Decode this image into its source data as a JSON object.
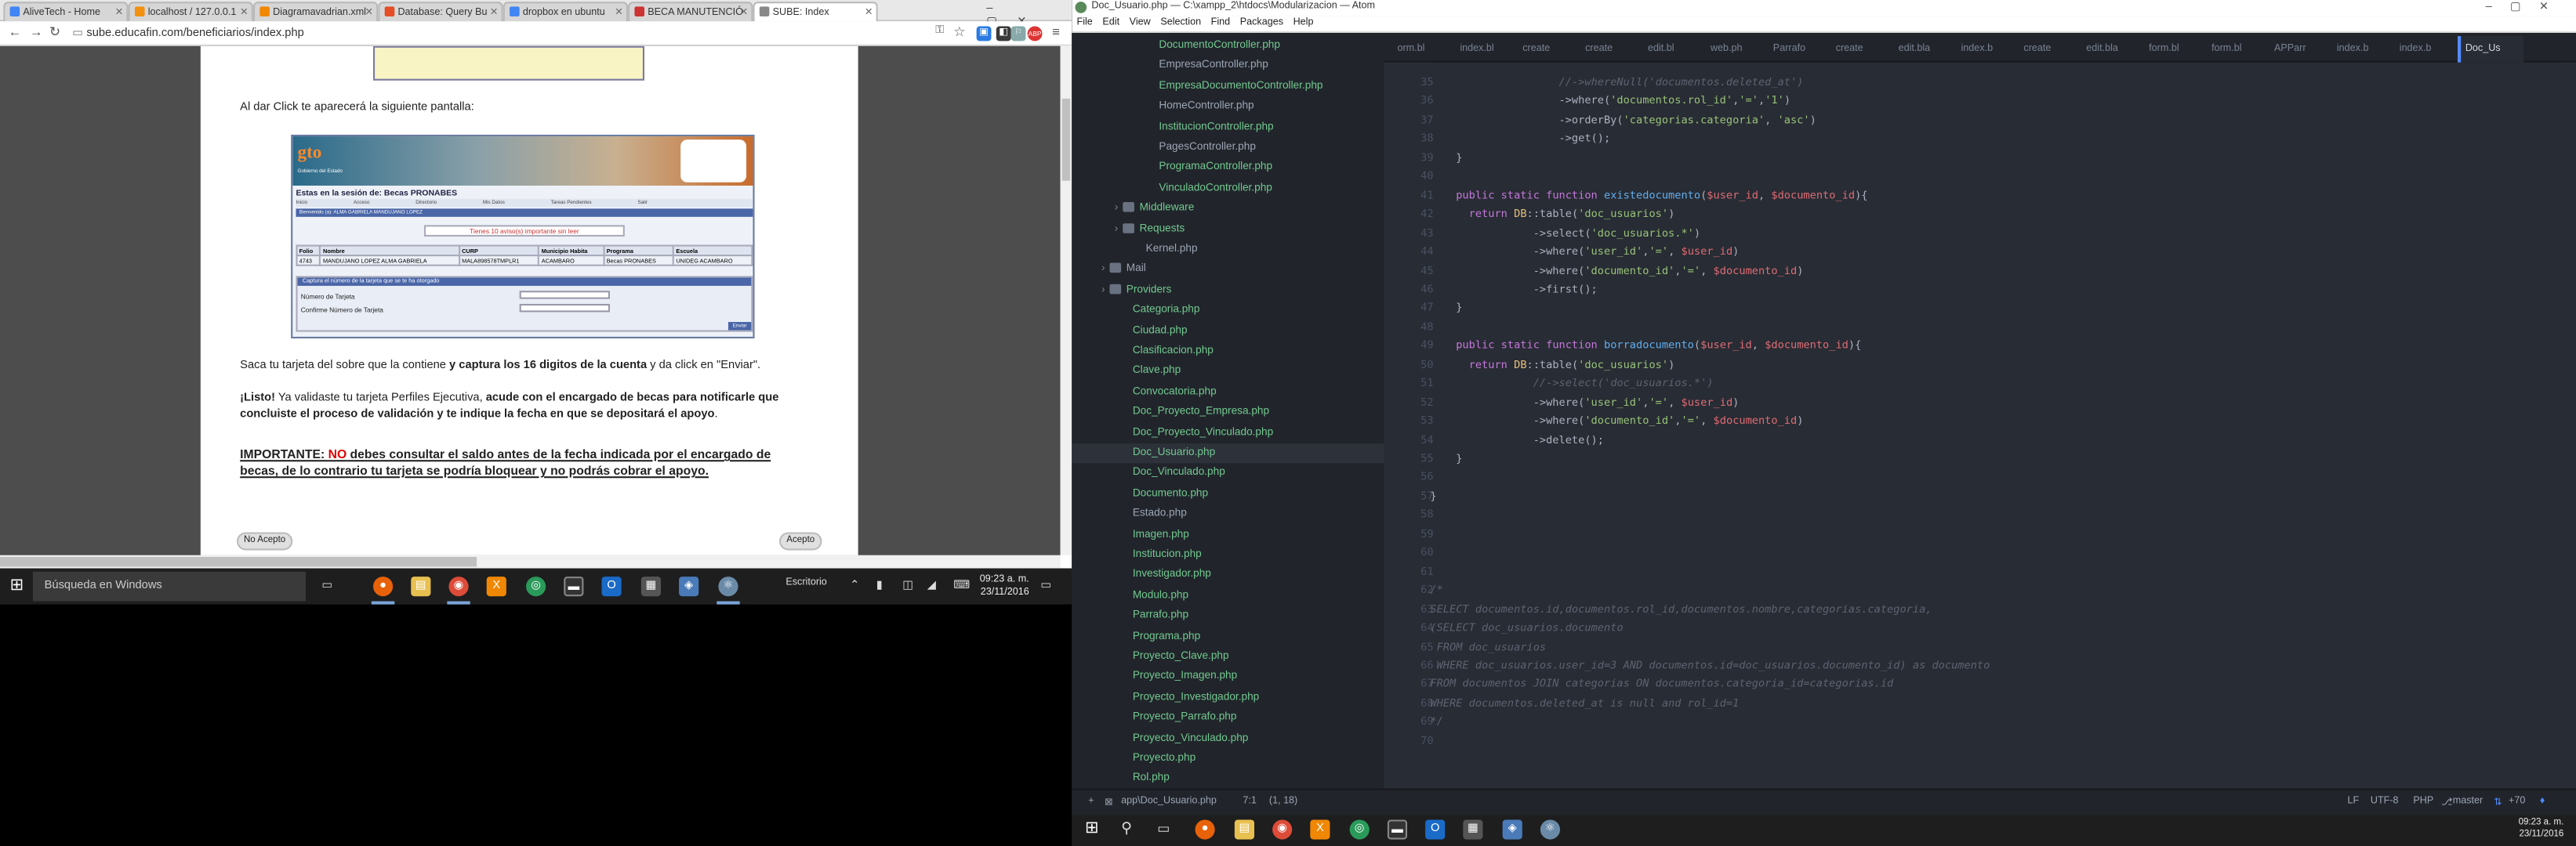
{
  "chrome": {
    "tabs": [
      {
        "label": "AliveTech - Home",
        "color": "#4285f4"
      },
      {
        "label": "localhost / 127.0.0.1",
        "color": "#f29111"
      },
      {
        "label": "Diagramavadrian.xml",
        "color": "#f08705"
      },
      {
        "label": "Database: Query Bu",
        "color": "#e44d26"
      },
      {
        "label": "dropbox en ubuntu",
        "color": "#4285f4"
      },
      {
        "label": "BECA MANUTENCIÓ",
        "color": "#c33"
      },
      {
        "label": "SUBE: Index",
        "color": "#888"
      }
    ],
    "url": "sube.educafin.com/beneficiarios/index.php",
    "page": {
      "intro": "Al dar Click te aparecerá la siguiente pantalla:",
      "para1_a": "Saca tu tarjeta del sobre que la contiene ",
      "para1_b": "y captura los 16 digitos de la cuenta",
      "para1_c": " y da click en \"Enviar\".",
      "para2_a": "¡Listo!",
      "para2_b": " Ya validaste tu tarjeta Perfiles Ejecutiva, ",
      "para2_c": "acude con el encargado de becas para notificarle que concluiste el proceso de validación y te indique la fecha en que se depositará el apoyo",
      "para2_d": ".",
      "para3_a": "IMPORTANTE: ",
      "para3_b": "NO",
      "para3_c": " debes consultar el saldo antes de la fecha indicada por el encargado de becas, de lo contrario tu tarjeta se podría bloquear y no podrás cobrar el apoyo.",
      "btn_no": "No Acepto",
      "btn_yes": "Acepto"
    },
    "portal": {
      "logo": "gto",
      "logo_sub": "Gobierno del Estado",
      "session": "Estas en la sesión de: Becas PRONABES",
      "nav": [
        "Inicio",
        "Acceso",
        "Directorio",
        "Mis Datos",
        "Tareas Pendientes",
        "Salir"
      ],
      "user": "Bienvenido (a): ALMA GABRIELA  MANDUJANO  LOPEZ",
      "vence": "Tienes 10 aviso(s) importante sin leer",
      "table_header": [
        "Folio",
        "Nombre",
        "CURP",
        "Municipio Habita",
        "Programa",
        "Escuela"
      ],
      "table_row": [
        "4743",
        "MANDUJANO LOPEZ ALMA GABRIELA",
        "MALA898578TMPLR1",
        "ACAMBARO",
        "Becas PRONABES",
        "UNIDEG ACAMBARO"
      ],
      "form_title": "Captura el número de la tarjeta que se te ha otorgado",
      "field1": "Número de Tarjeta",
      "field2": "Confirme Número de Tarjeta",
      "send": "Enviar"
    }
  },
  "taskbar1": {
    "search": "Búsqueda en Windows",
    "desk": "Escritorio",
    "time": "09:23 a. m.",
    "date": "23/11/2016"
  },
  "atom": {
    "title": "Doc_Usuario.php — C:\\xampp_2\\htdocs\\Modularizacion — Atom",
    "menu": [
      "File",
      "Edit",
      "View",
      "Selection",
      "Find",
      "Packages",
      "Help"
    ],
    "tree": [
      {
        "label": "DocumentoController.php",
        "indent": 2,
        "green": true
      },
      {
        "label": "EmpresaController.php",
        "indent": 2,
        "green": false
      },
      {
        "label": "EmpresaDocumentoController.php",
        "indent": 2,
        "green": true
      },
      {
        "label": "HomeController.php",
        "indent": 2,
        "green": false
      },
      {
        "label": "InstitucionController.php",
        "indent": 2,
        "green": true
      },
      {
        "label": "PagesController.php",
        "indent": 2,
        "green": false
      },
      {
        "label": "ProgramaController.php",
        "indent": 2,
        "green": true
      },
      {
        "label": "VinculadoController.php",
        "indent": 2,
        "green": true
      },
      {
        "label": "Middleware",
        "indent": 1,
        "green": true,
        "folder": true
      },
      {
        "label": "Requests",
        "indent": 1,
        "green": true,
        "folder": true
      },
      {
        "label": "Kernel.php",
        "indent": 1,
        "green": false
      },
      {
        "label": "Mail",
        "indent": 0,
        "green": false,
        "folder": true
      },
      {
        "label": "Providers",
        "indent": 0,
        "green": true,
        "folder": true
      },
      {
        "label": "Categoria.php",
        "indent": 0,
        "green": true
      },
      {
        "label": "Ciudad.php",
        "indent": 0,
        "green": true
      },
      {
        "label": "Clasificacion.php",
        "indent": 0,
        "green": true
      },
      {
        "label": "Clave.php",
        "indent": 0,
        "green": true
      },
      {
        "label": "Convocatoria.php",
        "indent": 0,
        "green": true
      },
      {
        "label": "Doc_Proyecto_Empresa.php",
        "indent": 0,
        "green": true
      },
      {
        "label": "Doc_Proyecto_Vinculado.php",
        "indent": 0,
        "green": true
      },
      {
        "label": "Doc_Usuario.php",
        "indent": 0,
        "green": true,
        "selected": true
      },
      {
        "label": "Doc_Vinculado.php",
        "indent": 0,
        "green": true
      },
      {
        "label": "Documento.php",
        "indent": 0,
        "green": true
      },
      {
        "label": "Estado.php",
        "indent": 0,
        "green": false
      },
      {
        "label": "Imagen.php",
        "indent": 0,
        "green": true
      },
      {
        "label": "Institucion.php",
        "indent": 0,
        "green": true
      },
      {
        "label": "Investigador.php",
        "indent": 0,
        "green": true
      },
      {
        "label": "Modulo.php",
        "indent": 0,
        "green": true
      },
      {
        "label": "Parrafo.php",
        "indent": 0,
        "green": true
      },
      {
        "label": "Programa.php",
        "indent": 0,
        "green": true
      },
      {
        "label": "Proyecto_Clave.php",
        "indent": 0,
        "green": true
      },
      {
        "label": "Proyecto_Imagen.php",
        "indent": 0,
        "green": true
      },
      {
        "label": "Proyecto_Investigador.php",
        "indent": 0,
        "green": true
      },
      {
        "label": "Proyecto_Parrafo.php",
        "indent": 0,
        "green": true
      },
      {
        "label": "Proyecto_Vinculado.php",
        "indent": 0,
        "green": true
      },
      {
        "label": "Proyecto.php",
        "indent": 0,
        "green": true
      },
      {
        "label": "Rol.php",
        "indent": 0,
        "green": true
      }
    ],
    "editor_tabs": [
      "orm.bl",
      "index.bl",
      "create",
      "create",
      "edit.bl",
      "web.ph",
      "Parrafo",
      "create",
      "edit.bla",
      "index.b",
      "create",
      "edit.bla",
      "form.bl",
      "form.bl",
      "APParr",
      "index.b",
      "index.b",
      "Doc_Us"
    ],
    "code": [
      {
        "n": 35,
        "t": "                    <span class='cm'>//->whereNull('documentos.deleted_at')</span>"
      },
      {
        "n": 36,
        "t": "                    ->where(<span class='st'>'documentos.rol_id'</span>,<span class='st'>'='</span>,<span class='st'>'1'</span>)"
      },
      {
        "n": 37,
        "t": "                    ->orderBy(<span class='st'>'categorias.categoria'</span>, <span class='st'>'asc'</span>)"
      },
      {
        "n": 38,
        "t": "                    ->get();"
      },
      {
        "n": 39,
        "t": "    }"
      },
      {
        "n": 40,
        "t": ""
      },
      {
        "n": 41,
        "t": "    <span class='kw'>public static function</span> <span class='fn'>existedocumento</span>(<span class='vr'>$user_id</span>, <span class='vr'>$documento_id</span>){"
      },
      {
        "n": 42,
        "t": "      <span class='kw'>return</span> <span class='cls'>DB</span>::table(<span class='st'>'doc_usuarios'</span>)"
      },
      {
        "n": 43,
        "t": "                ->select(<span class='st'>'doc_usuarios.*'</span>)"
      },
      {
        "n": 44,
        "t": "                ->where(<span class='st'>'user_id'</span>,<span class='st'>'='</span>, <span class='vr'>$user_id</span>)"
      },
      {
        "n": 45,
        "t": "                ->where(<span class='st'>'documento_id'</span>,<span class='st'>'='</span>, <span class='vr'>$documento_id</span>)"
      },
      {
        "n": 46,
        "t": "                ->first();"
      },
      {
        "n": 47,
        "t": "    }"
      },
      {
        "n": 48,
        "t": ""
      },
      {
        "n": 49,
        "t": "    <span class='kw'>public static function</span> <span class='fn'>borradocumento</span>(<span class='vr'>$user_id</span>, <span class='vr'>$documento_id</span>){"
      },
      {
        "n": 50,
        "t": "      <span class='kw'>return</span> <span class='cls'>DB</span>::table(<span class='st'>'doc_usuarios'</span>)"
      },
      {
        "n": 51,
        "t": "                <span class='cm'>//->select('doc_usuarios.*')</span>"
      },
      {
        "n": 52,
        "t": "                ->where(<span class='st'>'user_id'</span>,<span class='st'>'='</span>, <span class='vr'>$user_id</span>)"
      },
      {
        "n": 53,
        "t": "                ->where(<span class='st'>'documento_id'</span>,<span class='st'>'='</span>, <span class='vr'>$documento_id</span>)"
      },
      {
        "n": 54,
        "t": "                ->delete();"
      },
      {
        "n": 55,
        "t": "    }"
      },
      {
        "n": 56,
        "t": ""
      },
      {
        "n": 57,
        "t": "}"
      },
      {
        "n": 58,
        "t": ""
      },
      {
        "n": 59,
        "t": ""
      },
      {
        "n": 60,
        "t": ""
      },
      {
        "n": 61,
        "t": ""
      },
      {
        "n": 62,
        "t": "<span class='cm'>/*</span>"
      },
      {
        "n": 63,
        "t": "<span class='cm'>SELECT documentos.id,documentos.rol_id,documentos.nombre,categorias.categoria,</span>"
      },
      {
        "n": 64,
        "t": "<span class='cm'>(SELECT doc_usuarios.documento</span>"
      },
      {
        "n": 65,
        "t": "<span class='cm'> FROM doc_usuarios</span>"
      },
      {
        "n": 66,
        "t": "<span class='cm'> WHERE doc_usuarios.user_id=3 AND documentos.id=doc_usuarios.documento_id) as documento</span>"
      },
      {
        "n": 67,
        "t": "<span class='cm'>FROM documentos JOIN categorias ON documentos.categoria_id=categorias.id</span>"
      },
      {
        "n": 68,
        "t": "<span class='cm'>WHERE documentos.deleted_at is null and rol_id=1</span>"
      },
      {
        "n": 69,
        "t": "<span class='cm'>*/</span>"
      },
      {
        "n": 70,
        "t": ""
      }
    ],
    "status": {
      "path": "app\\Doc_Usuario.php",
      "pos": "7:1",
      "sel": "(1, 18)",
      "eol": "LF",
      "enc": "UTF-8",
      "lang": "PHP",
      "branch": "master",
      "diff": "+70"
    },
    "time": "09:23 a. m.",
    "date": "23/11/2016"
  }
}
